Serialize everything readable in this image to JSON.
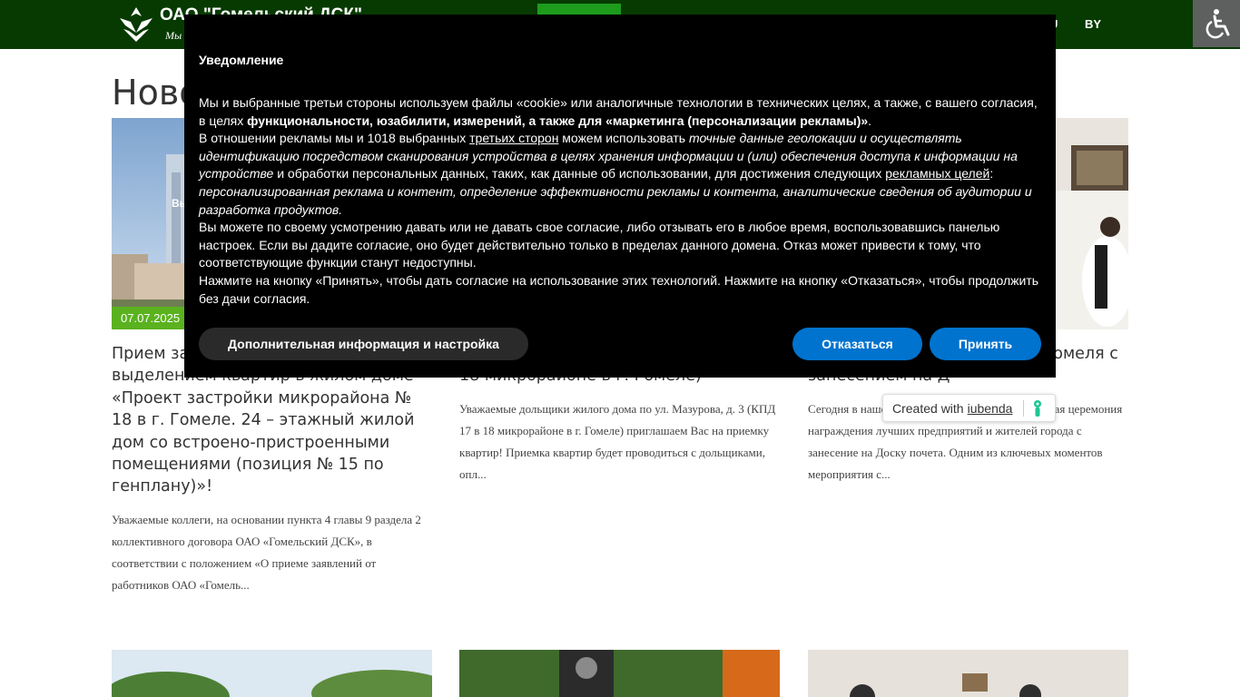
{
  "header": {
    "brand": "ОАО \"Гомельский ДСК\"",
    "slogan": "Мы",
    "languages": [
      "U",
      "BY"
    ]
  },
  "main": {
    "page_title": "Ново",
    "cards": [
      {
        "date": "07.07.2025",
        "title": "Прием за «Гомельский ДСК» с выделением квартир в жилом доме «Проект застройки микрорайона № 18 в г. Гомеле. 24 – этажный жилой дом со встроено-пристроенными помещениями (позиция № 15 по генплану)»!",
        "excerpt": "Уважаемые коллеги, на основании пункта 4 главы 9 раздела 2 коллективного договора ОАО «Гомельский ДСК», в соответствии с положением «О приеме заявлений от работников ОАО «Гомель..."
      },
      {
        "title": "доме по ул. Мазурова, д. 3 (КПД 17 в 18 микрорайоне в г. Гомеле)",
        "excerpt": "Уважаемые дольщики жилого дома по ул. Мазурова, д. 3 (КПД 17 в 18 микрорайоне в г. Гомеле) приглашаем Вас на приемку квартир! Приемка квартир будет проводиться с дольщиками, опл..."
      },
      {
        "title": "их предприятий и жителей Гомеля с занесением на Д",
        "excerpt": "Сегодня в нашем городе состоялась торжественная церемония награждения лучших предприятий и жителей города с занесение на Доску почета. Одним из ключевых моментов мероприятия с..."
      }
    ]
  },
  "consent": {
    "heading": "Уведомление",
    "p1_a": "Мы и выбранные третьи стороны используем файлы «cookie» или аналогичные технологии в технических целях, а также, с вашего согласия, в целях ",
    "p1_b": "функциональности, юзабилити, измерений, а также для «маркетинга (персонализации рекламы)»",
    "p1_c": ".",
    "p2_a": "В отношении рекламы мы и 1018 выбранных ",
    "p2_link1": "третьих сторон",
    "p2_b": " можем использовать ",
    "p2_c": "точные данные геолокации и осуществлять идентификацию посредством сканирования устройства в целях хранения информации и (или) обеспечения доступа к информации на устройстве",
    "p2_d": " и обработки персональных данных, таких, как данные об использовании, для достижения следующих ",
    "p2_link2": "рекламных целей",
    "p2_e": ": ",
    "p2_f": "персонализированная реклама и контент, определение эффективности рекламы и контента, аналитические сведения об аудитории и разработка продуктов.",
    "p3": "Вы можете по своему усмотрению давать или не давать свое согласие, либо отзывать его в любое время, воспользовавшись панелью настроек. Если вы дадите согласие, оно будет действительно только в пределах данного домена. Отказ может привести к тому, что соответствующие функции станут недоступны.",
    "p4": "Нажмите на кнопку «Принять», чтобы дать согласие на использование этих технологий. Нажмите на кнопку «Отказаться», чтобы продолжить без дачи согласия.",
    "more_label": "Дополнительная информация и настройка",
    "reject_label": "Отказаться",
    "accept_label": "Принять"
  },
  "iubenda": {
    "label": "Created with",
    "link": "iubenda"
  },
  "colors": {
    "header_bg": "#073a00",
    "date_badge": "#5ab21e",
    "consent_button": "#0073ce"
  }
}
